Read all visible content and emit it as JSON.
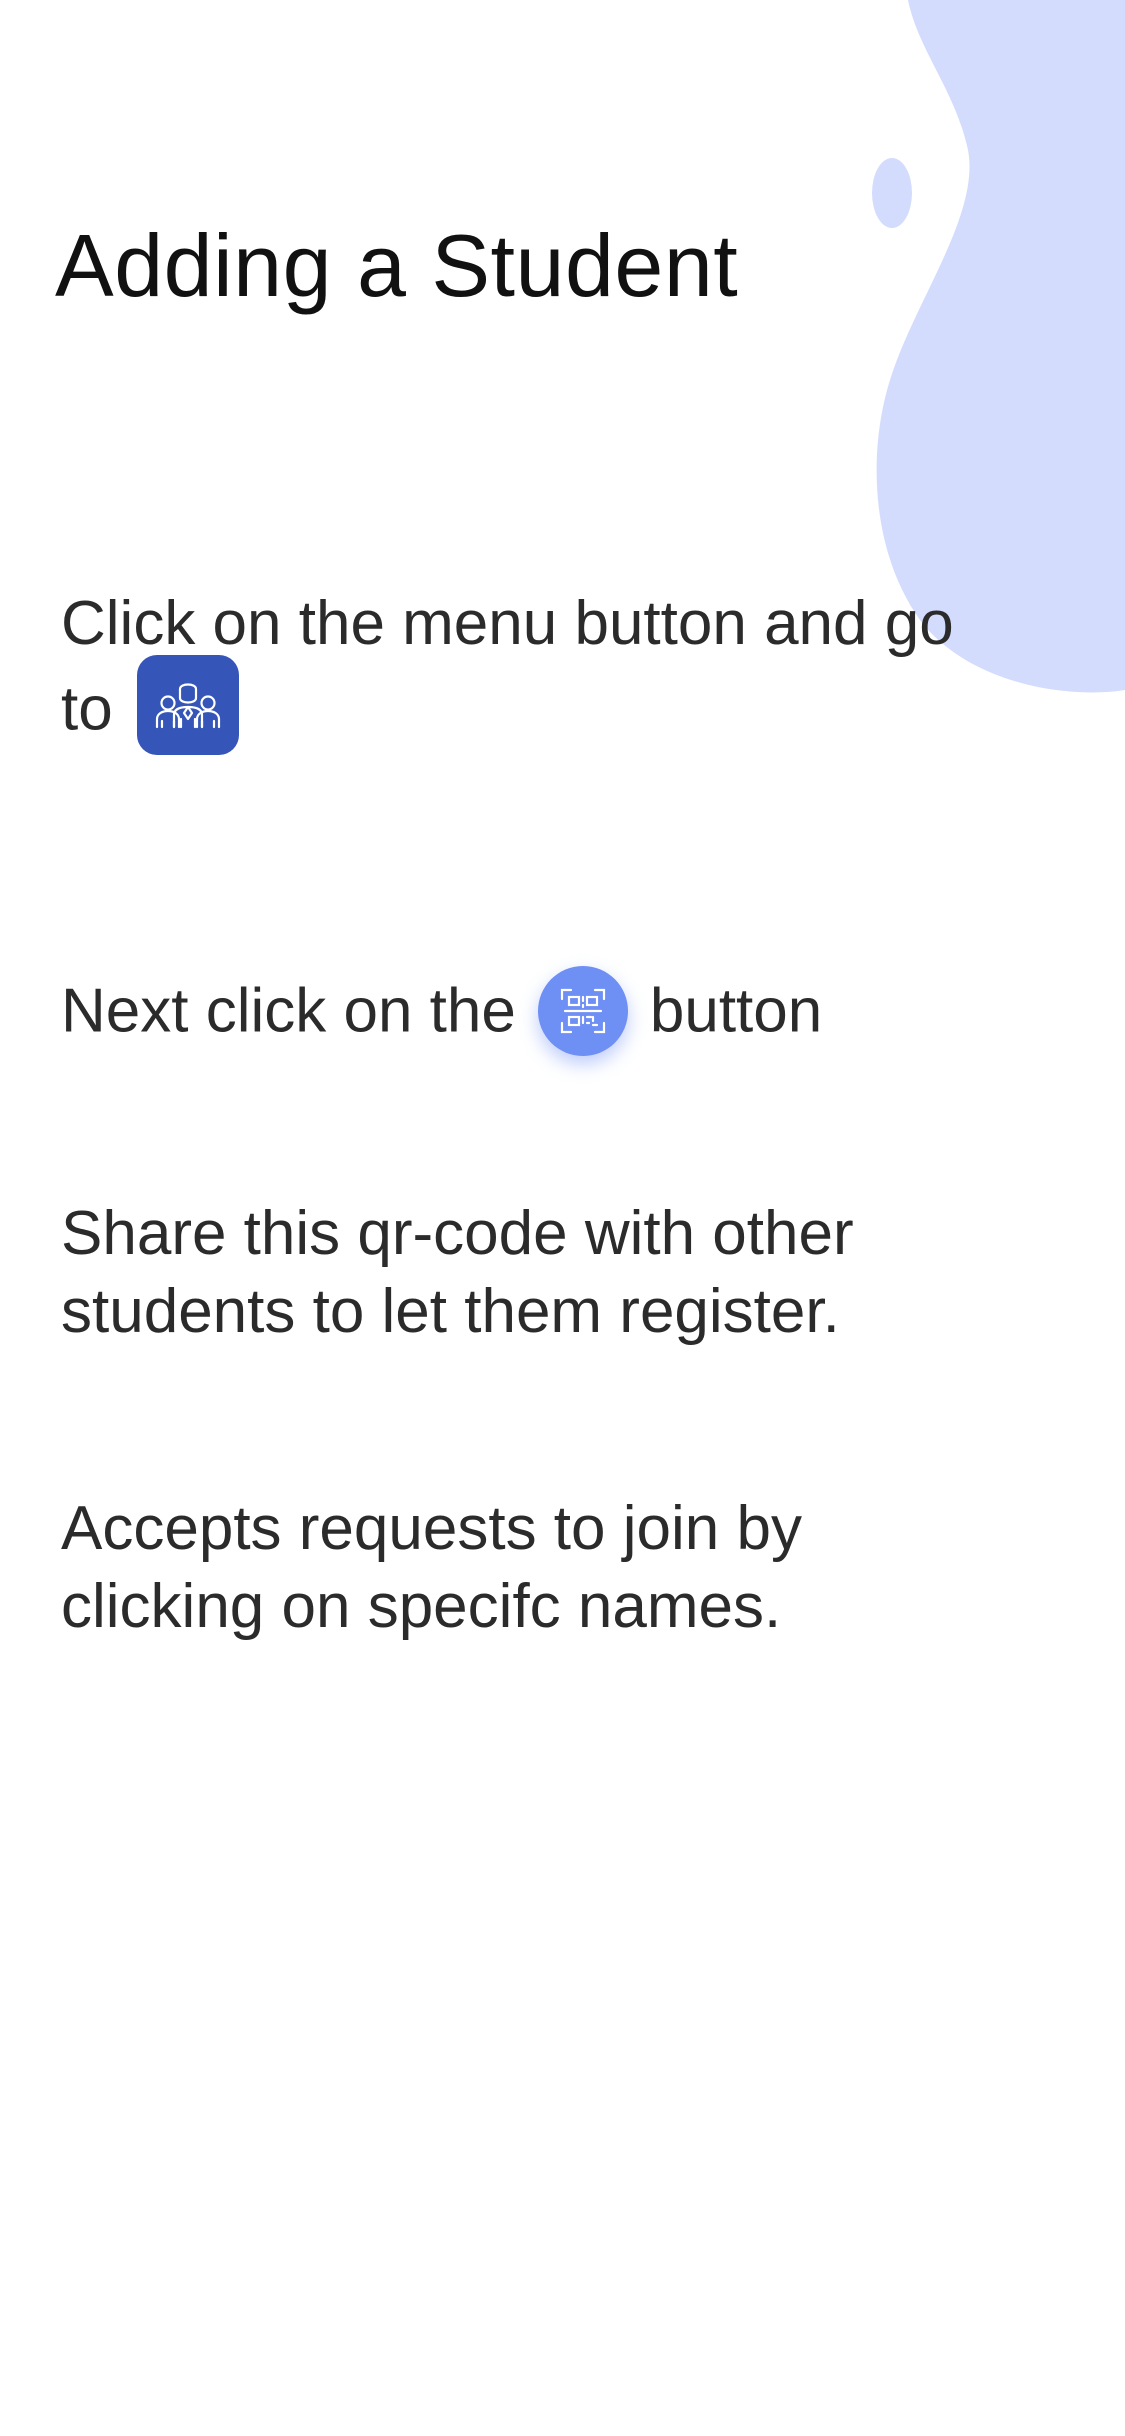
{
  "screen": {
    "title": "Adding a Student"
  },
  "steps": [
    {
      "before": "Click on the menu button and go to",
      "icon": "students-icon",
      "after": ""
    },
    {
      "before": "Next click on the",
      "icon": "qr-code-icon",
      "after": "button"
    },
    {
      "before": "Share this qr-code with other students to let them register."
    },
    {
      "before": "Accepts requests to join by clicking on specifc names."
    }
  ],
  "colors": {
    "blob": "#d3dcfd",
    "students_icon_bg": "#3556b8",
    "qr_icon_bg": "#6e8ff4",
    "text": "#2b2b2b"
  }
}
